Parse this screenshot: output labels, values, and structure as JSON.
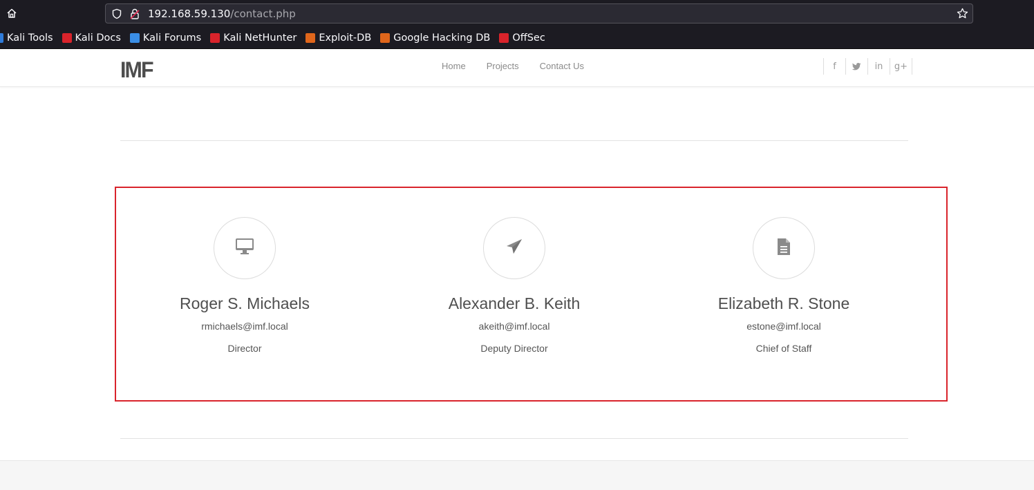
{
  "browser": {
    "url_host": "192.168.59.130",
    "url_path": "/contact.php",
    "bookmarks": [
      {
        "label": "Kali Tools",
        "color": "#2f7bd9"
      },
      {
        "label": "Kali Docs",
        "color": "#d9232b"
      },
      {
        "label": "Kali Forums",
        "color": "#3a8ee6"
      },
      {
        "label": "Kali NetHunter",
        "color": "#d9232b"
      },
      {
        "label": "Exploit-DB",
        "color": "#e0661b"
      },
      {
        "label": "Google Hacking DB",
        "color": "#e0661b"
      },
      {
        "label": "OffSec",
        "color": "#d9232b"
      }
    ]
  },
  "site": {
    "logo": "IMF",
    "nav": [
      "Home",
      "Projects",
      "Contact Us"
    ],
    "social": [
      "f",
      "t",
      "in",
      "g+"
    ]
  },
  "contacts": [
    {
      "name": "Roger S. Michaels",
      "email": "rmichaels@imf.local",
      "role": "Director",
      "icon": "desktop-icon"
    },
    {
      "name": "Alexander B. Keith",
      "email": "akeith@imf.local",
      "role": "Deputy Director",
      "icon": "paper-plane-icon"
    },
    {
      "name": "Elizabeth R. Stone",
      "email": "estone@imf.local",
      "role": "Chief of Staff",
      "icon": "document-icon"
    }
  ],
  "highlight_color": "#d9232b"
}
